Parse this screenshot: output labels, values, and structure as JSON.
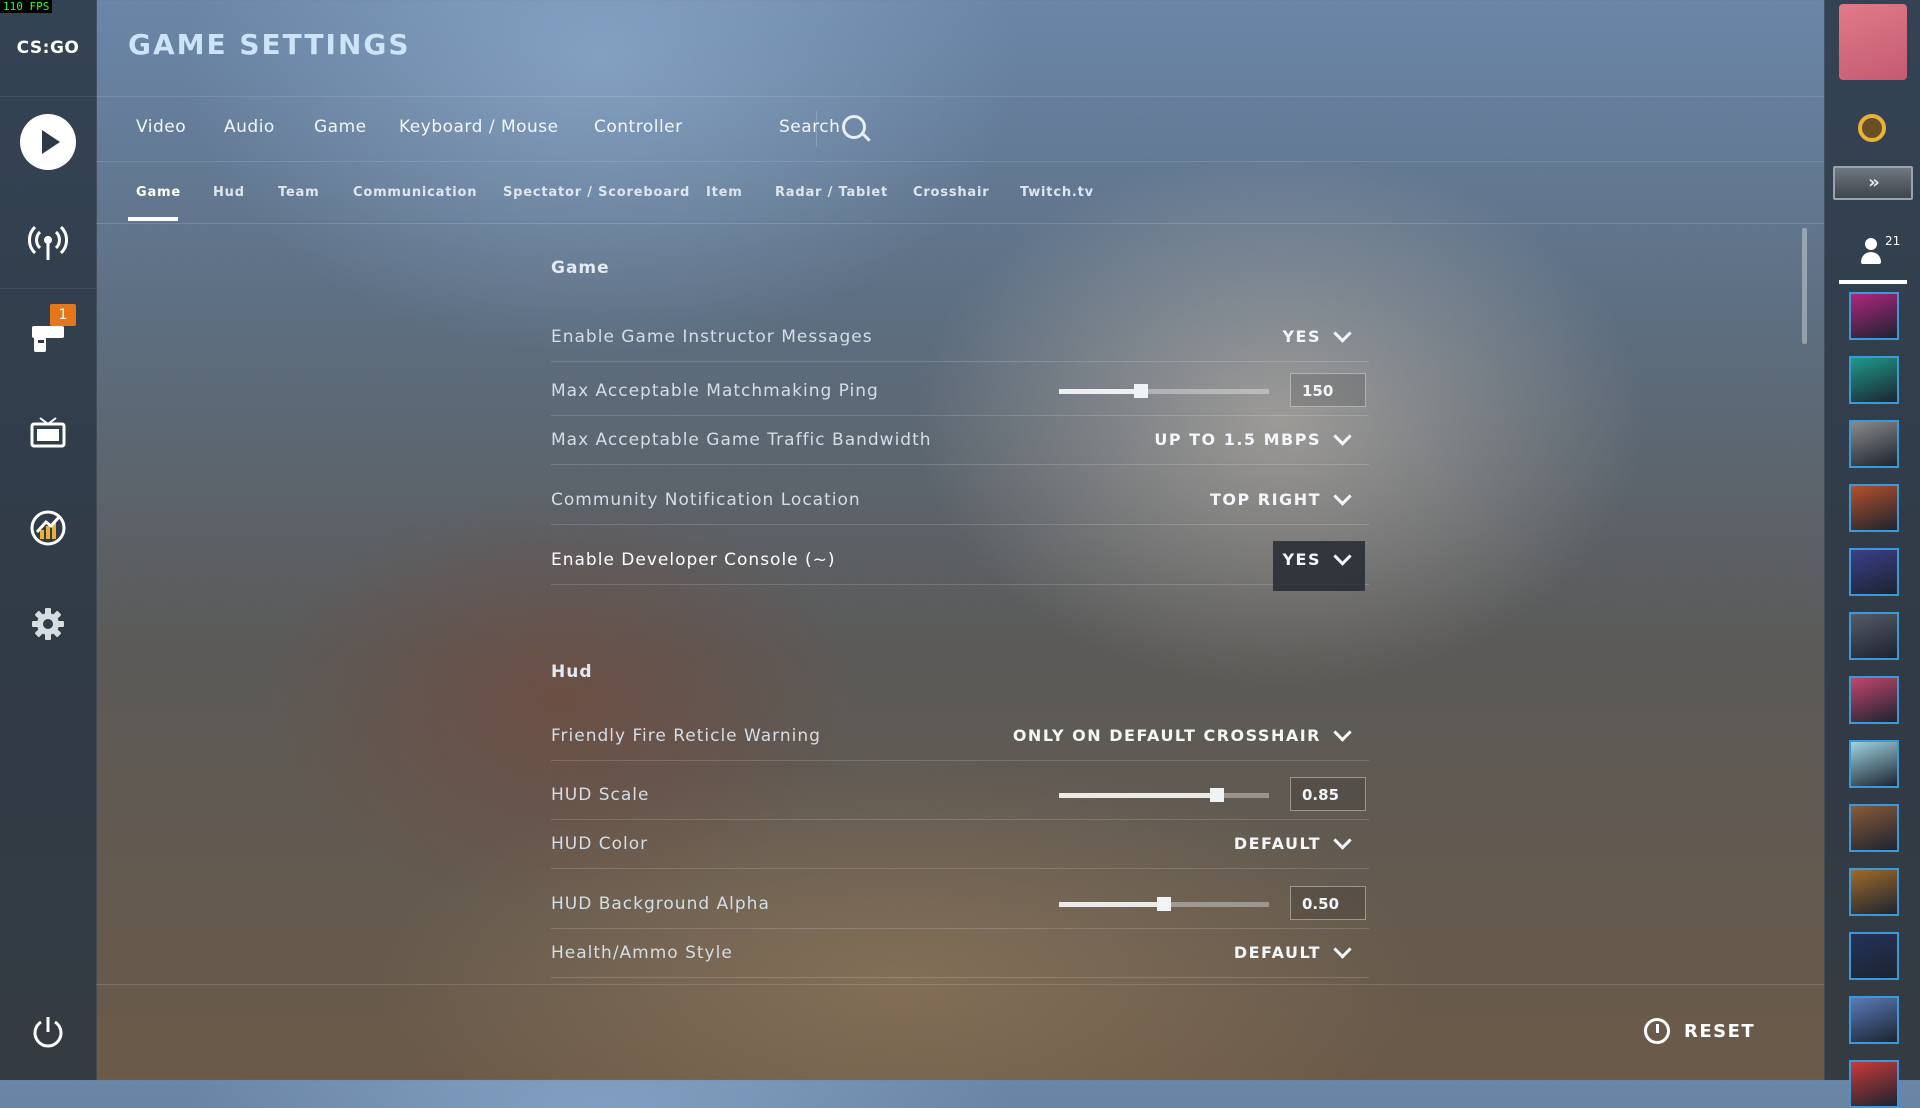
{
  "fps": "110 FPS",
  "app": {
    "logo": "CS:GO",
    "title": "GAME SETTINGS"
  },
  "sidebar": {
    "items": [
      {
        "name": "play",
        "icon": "play-icon"
      },
      {
        "name": "watch-broadcast",
        "icon": "broadcast-icon"
      },
      {
        "name": "inventory",
        "icon": "gun-icon",
        "badge": "1"
      },
      {
        "name": "watch",
        "icon": "tv-icon"
      },
      {
        "name": "stats",
        "icon": "stats-icon"
      },
      {
        "name": "settings",
        "icon": "gear-icon"
      },
      {
        "name": "quit",
        "icon": "power-icon"
      }
    ]
  },
  "tabs": [
    "Video",
    "Audio",
    "Game",
    "Keyboard / Mouse",
    "Controller"
  ],
  "search": {
    "label": "Search"
  },
  "subtabs": [
    "Game",
    "Hud",
    "Team",
    "Communication",
    "Spectator / Scoreboard",
    "Item",
    "Radar / Tablet",
    "Crosshair",
    "Twitch.tv"
  ],
  "active_subtab": "Game",
  "sections": {
    "game": {
      "title": "Game",
      "rows": [
        {
          "label": "Enable Game Instructor Messages",
          "type": "dropdown",
          "value": "YES"
        },
        {
          "label": "Max Acceptable Matchmaking Ping",
          "type": "slider",
          "value": "150",
          "fraction": 0.39
        },
        {
          "label": "Max Acceptable Game Traffic Bandwidth",
          "type": "dropdown",
          "value": "UP TO 1.5 MBPS"
        },
        {
          "label": "Community Notification Location",
          "type": "dropdown",
          "value": "TOP RIGHT"
        },
        {
          "label": "Enable Developer Console (~)",
          "type": "dropdown",
          "value": "YES",
          "highlighted": true
        }
      ]
    },
    "hud": {
      "title": "Hud",
      "rows": [
        {
          "label": "Friendly Fire Reticle Warning",
          "type": "dropdown",
          "value": "ONLY ON DEFAULT CROSSHAIR"
        },
        {
          "label": "HUD Scale",
          "type": "slider",
          "value": "0.85",
          "fraction": 0.75
        },
        {
          "label": "HUD Color",
          "type": "dropdown",
          "value": "DEFAULT"
        },
        {
          "label": "HUD Background Alpha",
          "type": "slider",
          "value": "0.50",
          "fraction": 0.5
        },
        {
          "label": "Health/Ammo Style",
          "type": "dropdown",
          "value": "DEFAULT"
        }
      ]
    }
  },
  "footer": {
    "reset_label": "RESET"
  },
  "rightbar": {
    "rank_label": "»",
    "friends_count": "21",
    "friend_avatar_colors": [
      "#b0257e",
      "#1f9a8a",
      "#8a8a8a",
      "#b5502a",
      "#3b3f8a",
      "#555a66",
      "#c2466a",
      "#9fd3e0",
      "#8a5a3a",
      "#a06a2a",
      "#24325a",
      "#5a7ab8",
      "#c83a3a"
    ]
  },
  "colors": {
    "accent": "#ffffff",
    "notification_badge": "#e4761b",
    "friend_border": "#3a9ad9"
  }
}
